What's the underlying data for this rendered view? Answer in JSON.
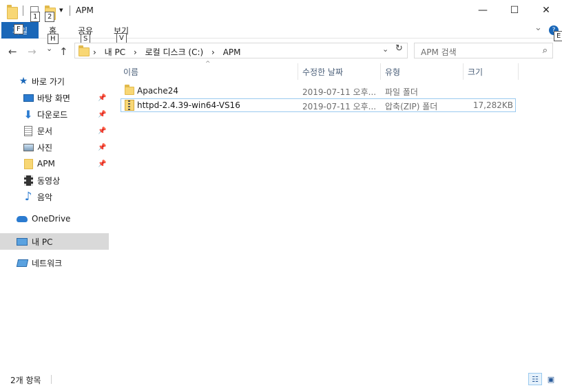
{
  "window": {
    "title": "APM",
    "minimize": "—",
    "maximize": "☐",
    "close": "✕"
  },
  "quick_access_toolbar": {
    "dropdown": "▾",
    "keytip_properties": "1",
    "keytip_new_folder": "2"
  },
  "ribbon": {
    "file_tab": "파일",
    "file_keytip": "F",
    "tabs": [
      {
        "label": "홈",
        "keytip": "H"
      },
      {
        "label": "공유",
        "keytip": "S"
      },
      {
        "label": "보기",
        "keytip": "V"
      }
    ],
    "expand_chevron": "⌄",
    "help_badge": "?",
    "help_keytip": "E"
  },
  "navigation": {
    "back": "←",
    "forward": "→",
    "recent": "⌄",
    "up": "↑"
  },
  "address_bar": {
    "sep": "›",
    "crumbs": [
      "내 PC",
      "로컬 디스크 (C:)",
      "APM"
    ],
    "dropdown": "⌄",
    "refresh": "↻"
  },
  "search": {
    "placeholder": "APM 검색",
    "icon": "⌕"
  },
  "nav_pane": {
    "quick_access": "바로 가기",
    "pin_glyph": "📌",
    "items": [
      {
        "label": "바탕 화면",
        "icon": "desktop-icon",
        "pinned": true
      },
      {
        "label": "다운로드",
        "icon": "download-icon",
        "pinned": true
      },
      {
        "label": "문서",
        "icon": "document-icon",
        "pinned": true
      },
      {
        "label": "사진",
        "icon": "pictures-icon",
        "pinned": true
      },
      {
        "label": "APM",
        "icon": "folder-icon",
        "pinned": true
      },
      {
        "label": "동영상",
        "icon": "video-icon",
        "pinned": false
      },
      {
        "label": "음악",
        "icon": "music-icon",
        "pinned": false
      }
    ],
    "onedrive": "OneDrive",
    "this_pc": "내 PC",
    "network": "네트워크"
  },
  "columns": {
    "name": "이름",
    "sort_indicator": "^",
    "date": "수정한 날짜",
    "type": "유형",
    "size": "크기"
  },
  "files": [
    {
      "name": "Apache24",
      "date": "2019-07-11 오후...",
      "type": "파일 폴더",
      "size": "",
      "icon": "folder-icon"
    },
    {
      "name": "httpd-2.4.39-win64-VS16",
      "date": "2019-07-11 오후...",
      "type": "압축(ZIP) 폴더",
      "size": "17,282KB",
      "icon": "zip-folder-icon"
    }
  ],
  "status_bar": {
    "item_count": "2개 항목"
  },
  "colors": {
    "accent": "#1a67b8",
    "selection_border": "#99c9ef",
    "selected_nav": "#d9d9d9",
    "column_header_text": "#4c607a"
  }
}
